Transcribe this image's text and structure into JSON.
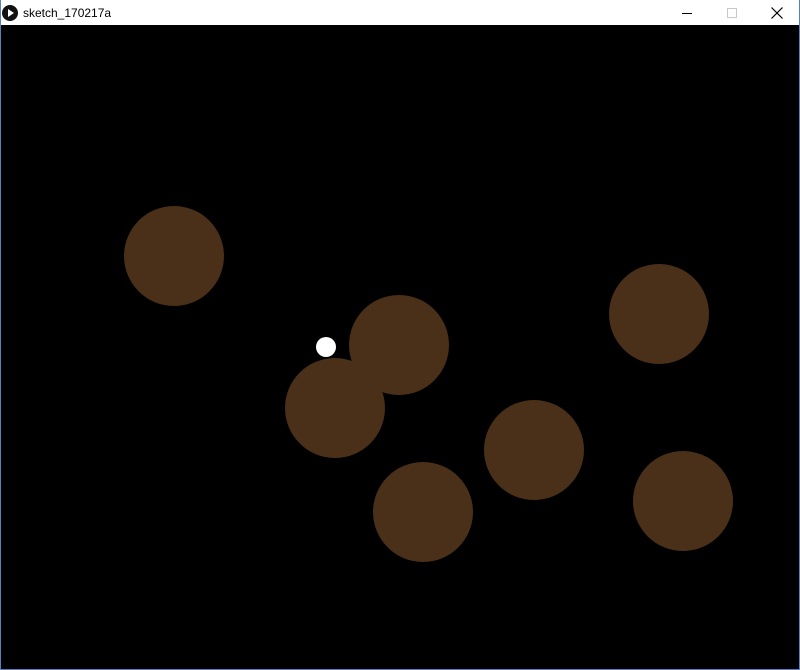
{
  "window": {
    "title": "sketch_170217a"
  },
  "icons": {
    "app": "processing-play-icon",
    "minimize": "minimize-icon",
    "maximize": "maximize-icon",
    "close": "close-icon"
  },
  "colors": {
    "background": "#000000",
    "ball": "#ffffff",
    "obstacle": "#4a3018"
  }
}
